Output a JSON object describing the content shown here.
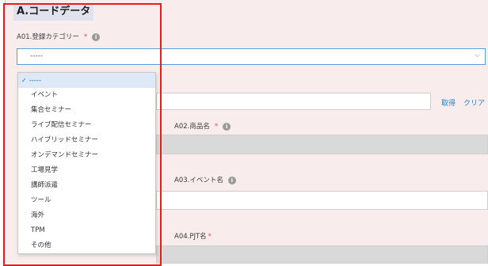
{
  "section": {
    "title": "A.コードデータ"
  },
  "fields": {
    "a01": {
      "label": "A01.登録カテゴリー",
      "required": "*",
      "info": "i",
      "value": "-----",
      "chevron": "⌵"
    },
    "a02": {
      "label": "A02.商品名",
      "required": "*",
      "info": "i"
    },
    "a03": {
      "label": "A03.イベント名",
      "info": "i"
    },
    "a04": {
      "label": "A04.PJT名",
      "required": "*"
    }
  },
  "links": {
    "get": "取得",
    "clear": "クリア"
  },
  "dropdown": {
    "selected_check": "✓",
    "options": [
      "-----",
      "イベント",
      "集合セミナー",
      "ライブ配信セミナー",
      "ハイブリッドセミナー",
      "オンデマンドセミナー",
      "工場見学",
      "講師派遣",
      "ツール",
      "海外",
      "TPM",
      "その他"
    ]
  }
}
